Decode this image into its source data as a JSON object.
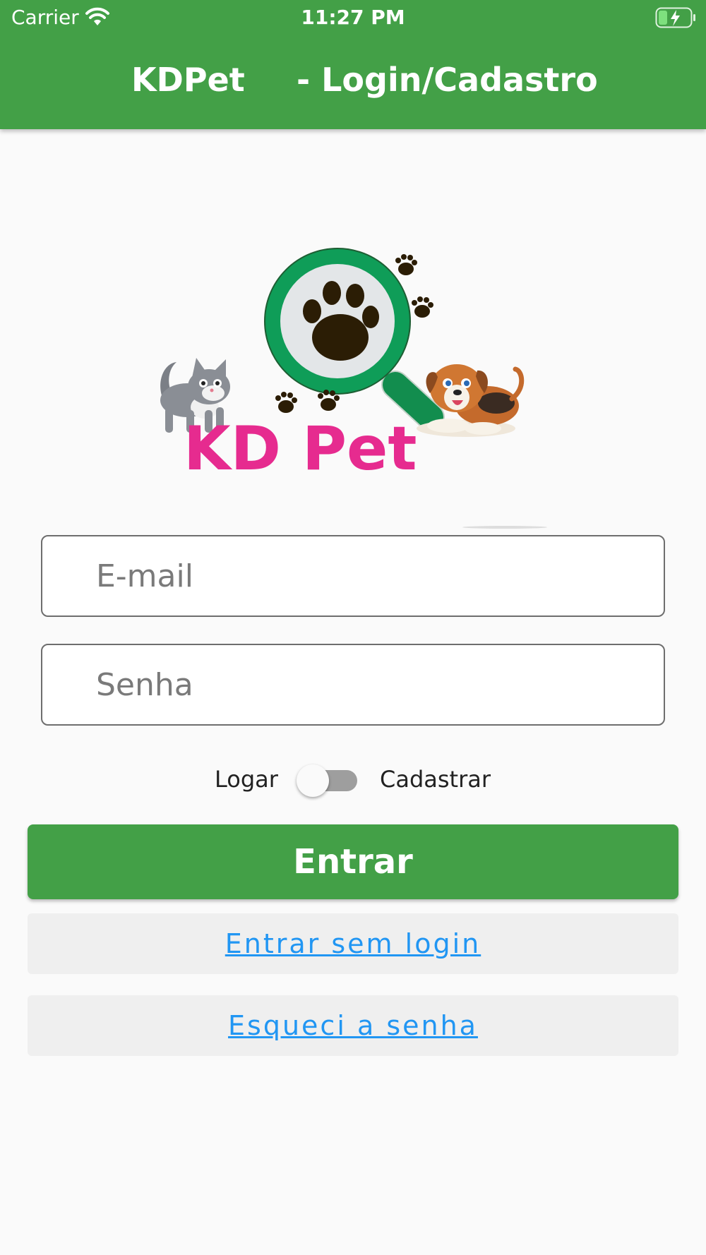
{
  "status_bar": {
    "carrier": "Carrier",
    "time": "11:27 PM"
  },
  "app_bar": {
    "app_name": "KDPet",
    "title": "- Login/Cadastro"
  },
  "logo": {
    "text": "KD Pet"
  },
  "form": {
    "email": {
      "placeholder": "E-mail",
      "value": ""
    },
    "password": {
      "placeholder": "Senha",
      "value": ""
    }
  },
  "mode_toggle": {
    "left_label": "Logar",
    "right_label": "Cadastrar",
    "is_on": false
  },
  "buttons": {
    "submit": "Entrar",
    "guest": "Entrar sem login",
    "forgot": "Esqueci a senha"
  },
  "colors": {
    "primary": "#43a047",
    "link": "#2196f3",
    "logo_text": "#e62b8f",
    "logo_ring": "#0f9d58"
  }
}
